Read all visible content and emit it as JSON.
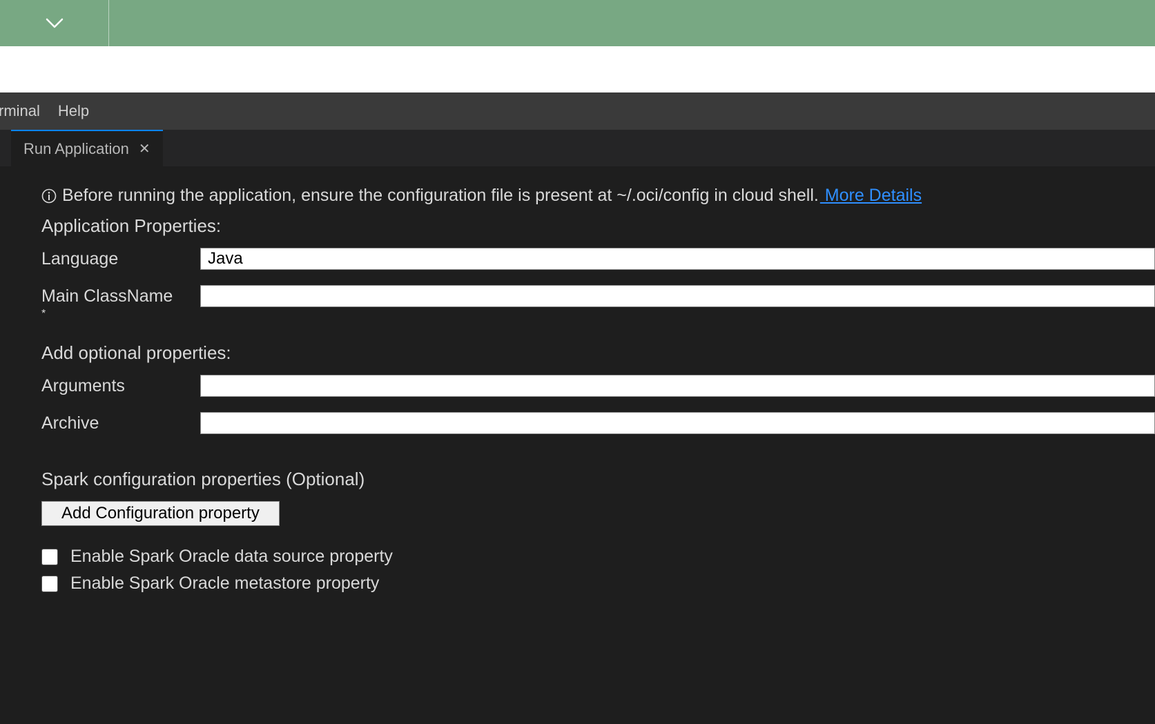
{
  "menu": {
    "terminal": "rminal",
    "help": "Help"
  },
  "tab": {
    "label": "Run Application"
  },
  "info": {
    "message": "Before running the application, ensure the configuration file is present at ~/.oci/config in cloud shell.",
    "more_label": " More Details"
  },
  "sections": {
    "app_props": "Application Properties:",
    "optional_props": "Add optional properties:",
    "spark_props": "Spark configuration properties (Optional)"
  },
  "form": {
    "language_label": "Language",
    "language_value": "Java",
    "main_class_label": "Main ClassName",
    "main_class_required": "*",
    "main_class_value": "",
    "arguments_label": "Arguments",
    "arguments_value": "",
    "archive_label": "Archive",
    "archive_value": ""
  },
  "buttons": {
    "add_config": "Add Configuration property"
  },
  "checkboxes": {
    "spark_ds": "Enable Spark Oracle data source property",
    "spark_meta": "Enable Spark Oracle metastore property"
  }
}
